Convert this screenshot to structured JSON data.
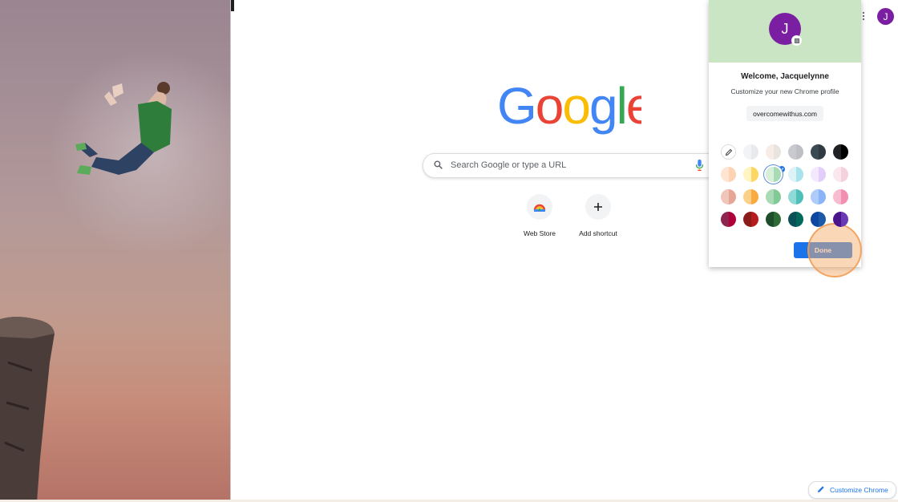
{
  "logo": {
    "letters": [
      "G",
      "o",
      "o",
      "g",
      "l",
      "e"
    ],
    "colors": [
      "#4285F4",
      "#EA4335",
      "#FBBC05",
      "#4285F4",
      "#34A853",
      "#EA4335"
    ]
  },
  "search": {
    "placeholder": "Search Google or type a URL",
    "icon": "search-icon",
    "voice_icon": "microphone-icon"
  },
  "shortcuts": [
    {
      "label": "Web Store",
      "icon": "web-store-icon"
    },
    {
      "label": "Add shortcut",
      "icon": "plus-icon"
    }
  ],
  "header": {
    "avatar_initial": "J",
    "apps_icon": "apps-grid-icon"
  },
  "profile_panel": {
    "avatar_initial": "J",
    "avatar_color": "#7b1fa2",
    "header_color": "#c9e5c3",
    "welcome": "Welcome, Jacquelynne",
    "subtitle": "Customize your new Chrome profile",
    "domain": "overcomewithus.com",
    "done_label": "Done",
    "swatches": [
      [
        "#f1f3f4",
        "#e8eaed"
      ],
      [
        "#f7ece6",
        "#e9e3e0"
      ],
      [
        "#c8cacf",
        "#bdbfc4"
      ],
      [
        "#3c4a53",
        "#2f3a41"
      ],
      [
        "#202124",
        "#000000"
      ],
      [
        "#fde4d3",
        "#fdd3b3"
      ],
      [
        "#fff4c2",
        "#fdd663"
      ],
      [
        "#d7efd9",
        "#a8dab5"
      ],
      [
        "#def3f7",
        "#a8e2ec"
      ],
      [
        "#f3e8fd",
        "#e3cdfb"
      ],
      [
        "#fbe8ef",
        "#f5d1de"
      ],
      [
        "#f0c6bb",
        "#e6a596"
      ],
      [
        "#fdd08a",
        "#f9ab41"
      ],
      [
        "#a8dab5",
        "#81c995"
      ],
      [
        "#8fd9d6",
        "#4fbfba"
      ],
      [
        "#aecbfa",
        "#8ab4f8"
      ],
      [
        "#f8bbd0",
        "#f48fb1"
      ],
      [
        "#8e2450",
        "#b0003a"
      ],
      [
        "#8a1c1c",
        "#b71c1c"
      ],
      [
        "#1e4d2b",
        "#2e6b35"
      ],
      [
        "#0b4f57",
        "#00695c"
      ],
      [
        "#0d47a1",
        "#1c5aa8"
      ],
      [
        "#4a148c",
        "#6a3ab5"
      ]
    ],
    "selected_index": 7
  },
  "customize_chrome": {
    "label": "Customize Chrome",
    "icon": "pencil-icon"
  }
}
